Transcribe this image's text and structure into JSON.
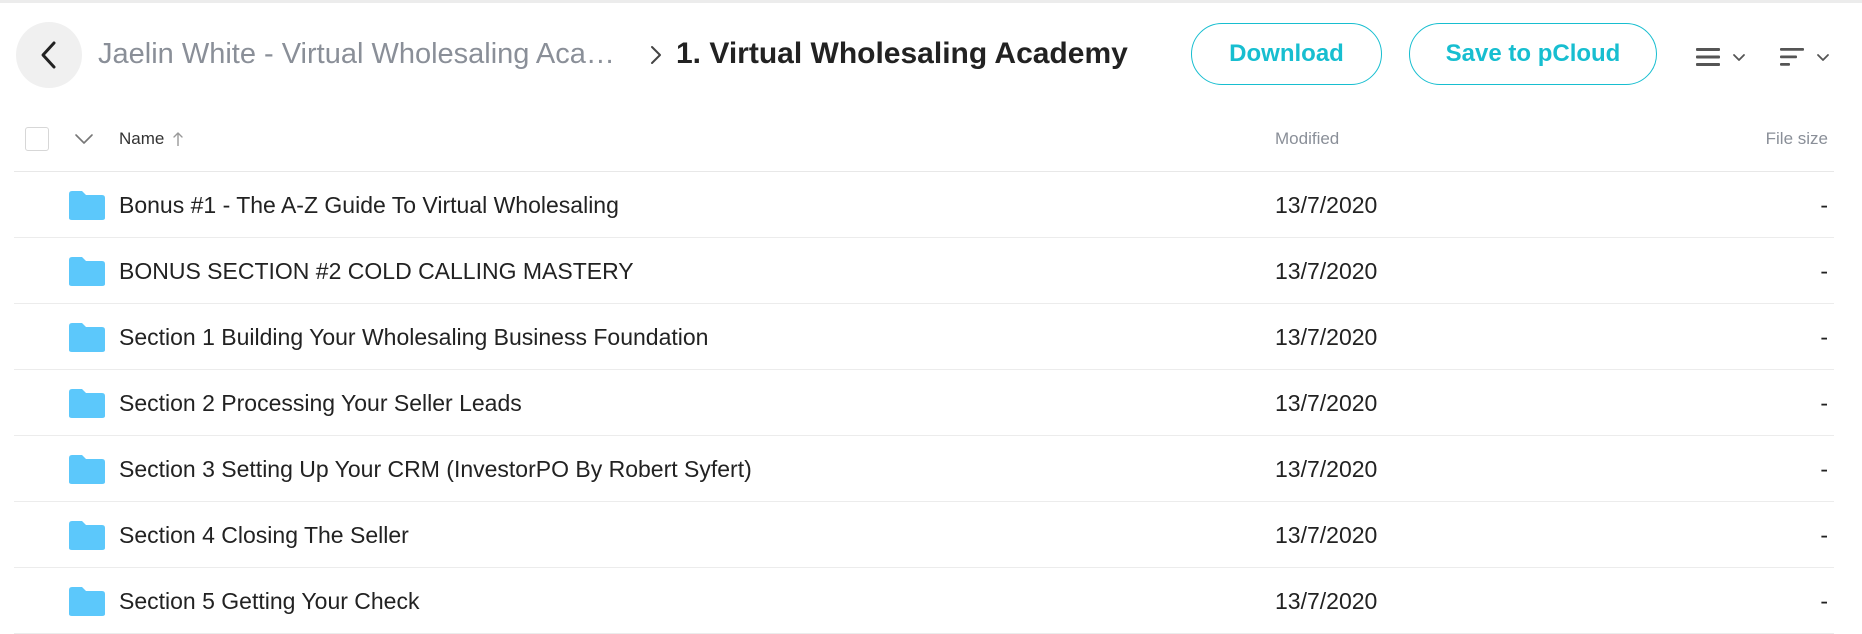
{
  "breadcrumb": {
    "parent": "Jaelin White - Virtual Wholesaling Academy",
    "current": "1. Virtual Wholesaling Academy"
  },
  "actions": {
    "download_label": "Download",
    "save_label": "Save to pCloud"
  },
  "columns": {
    "name": "Name",
    "modified": "Modified",
    "size": "File size"
  },
  "files": [
    {
      "name": "Bonus #1 - The A-Z Guide To Virtual Wholesaling",
      "modified": "13/7/2020",
      "size": "-"
    },
    {
      "name": "BONUS SECTION #2 COLD CALLING MASTERY",
      "modified": "13/7/2020",
      "size": "-"
    },
    {
      "name": "Section 1 Building Your Wholesaling Business Foundation",
      "modified": "13/7/2020",
      "size": "-"
    },
    {
      "name": "Section 2 Processing Your Seller Leads",
      "modified": "13/7/2020",
      "size": "-"
    },
    {
      "name": "Section 3 Setting Up Your CRM (InvestorPO By Robert Syfert)",
      "modified": "13/7/2020",
      "size": "-"
    },
    {
      "name": "Section 4 Closing The Seller",
      "modified": "13/7/2020",
      "size": "-"
    },
    {
      "name": "Section 5 Getting Your Check",
      "modified": "13/7/2020",
      "size": "-"
    }
  ],
  "icons": {
    "back": "arrow-left-icon",
    "separator": "chevron-right-icon",
    "view": "list-view-icon",
    "sort": "sort-icon",
    "folder": "folder-icon",
    "sort_dir": "arrow-up-icon"
  },
  "colors": {
    "accent": "#17bed0",
    "folder": "#5cc8fb"
  }
}
